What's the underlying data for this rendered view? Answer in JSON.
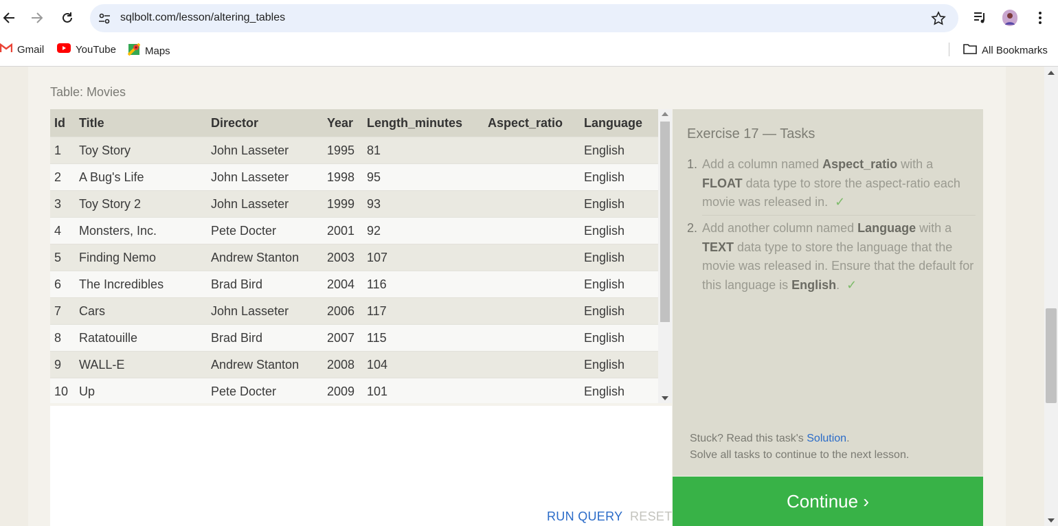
{
  "browser": {
    "url": "sqlbolt.com/lesson/altering_tables",
    "bookmarks": [
      {
        "label": "Gmail",
        "icon": "gmail-icon"
      },
      {
        "label": "YouTube",
        "icon": "youtube-icon"
      },
      {
        "label": "Maps",
        "icon": "maps-icon"
      }
    ],
    "all_bookmarks": "All Bookmarks"
  },
  "table": {
    "label": "Table: Movies",
    "columns": [
      "Id",
      "Title",
      "Director",
      "Year",
      "Length_minutes",
      "Aspect_ratio",
      "Language"
    ],
    "rows": [
      [
        "1",
        "Toy Story",
        "John Lasseter",
        "1995",
        "81",
        "",
        "English"
      ],
      [
        "2",
        "A Bug's Life",
        "John Lasseter",
        "1998",
        "95",
        "",
        "English"
      ],
      [
        "3",
        "Toy Story 2",
        "John Lasseter",
        "1999",
        "93",
        "",
        "English"
      ],
      [
        "4",
        "Monsters, Inc.",
        "Pete Docter",
        "2001",
        "92",
        "",
        "English"
      ],
      [
        "5",
        "Finding Nemo",
        "Andrew Stanton",
        "2003",
        "107",
        "",
        "English"
      ],
      [
        "6",
        "The Incredibles",
        "Brad Bird",
        "2004",
        "116",
        "",
        "English"
      ],
      [
        "7",
        "Cars",
        "John Lasseter",
        "2006",
        "117",
        "",
        "English"
      ],
      [
        "8",
        "Ratatouille",
        "Brad Bird",
        "2007",
        "115",
        "",
        "English"
      ],
      [
        "9",
        "WALL-E",
        "Andrew Stanton",
        "2008",
        "104",
        "",
        "English"
      ],
      [
        "10",
        "Up",
        "Pete Docter",
        "2009",
        "101",
        "",
        "English"
      ]
    ]
  },
  "query": {
    "run_label": "RUN QUERY",
    "reset_label": "RESET"
  },
  "tasks": {
    "title": "Exercise 17 — Tasks",
    "items": [
      {
        "num": "1.",
        "t1": "Add a column named ",
        "b1": "Aspect_ratio",
        "t2": " with a ",
        "b2": "FLOAT",
        "t3": " data type to store the aspect-ratio each movie was released in.",
        "check": "✓"
      },
      {
        "num": "2.",
        "t1": "Add another column named ",
        "b1": "Language",
        "t2": " with a ",
        "b2": "TEXT",
        "t3": " data type to store the language that the movie was released in. Ensure that the default for this language is ",
        "b3": "English",
        "t4": ".",
        "check": "✓"
      }
    ],
    "stuck_text": "Stuck? Read this task's ",
    "solution_link": "Solution",
    "stuck_end": ".",
    "solve_text": "Solve all tasks to continue to the next lesson.",
    "continue_label": "Continue ›"
  },
  "colors": {
    "continue_bg": "#38b247",
    "link": "#2a6bc8",
    "omnibox_bg": "#eaf0fb"
  }
}
